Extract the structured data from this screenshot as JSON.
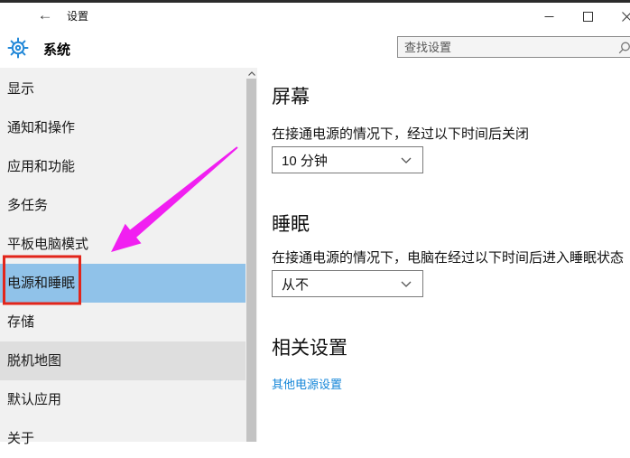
{
  "window": {
    "title": "设置",
    "controls": {
      "minimize": "minimize",
      "maximize": "maximize",
      "close": "close"
    }
  },
  "icons": {
    "back": "←"
  },
  "header": {
    "page_title": "系统",
    "search": {
      "placeholder": "查找设置"
    }
  },
  "sidebar": {
    "items": [
      {
        "label": "显示",
        "state": "normal"
      },
      {
        "label": "通知和操作",
        "state": "normal"
      },
      {
        "label": "应用和功能",
        "state": "normal"
      },
      {
        "label": "多任务",
        "state": "normal"
      },
      {
        "label": "平板电脑模式",
        "state": "normal"
      },
      {
        "label": "电源和睡眠",
        "state": "selected"
      },
      {
        "label": "存储",
        "state": "normal"
      },
      {
        "label": "脱机地图",
        "state": "hovered"
      },
      {
        "label": "默认应用",
        "state": "normal"
      },
      {
        "label": "关于",
        "state": "normal"
      }
    ]
  },
  "main": {
    "sections": [
      {
        "heading": "屏幕",
        "description": "在接通电源的情况下，经过以下时间后关闭",
        "dropdown_value": "10 分钟"
      },
      {
        "heading": "睡眠",
        "description": "在接通电源的情况下，电脑在经过以下时间后进入睡眠状态",
        "dropdown_value": "从不"
      },
      {
        "heading": "相关设置",
        "link_label": "其他电源设置"
      }
    ]
  },
  "annotations": {
    "arrow_color": "#f11ff1",
    "box_color": "#e2251b"
  },
  "colors": {
    "accent_gear": "#2288d8",
    "selected_item_bg": "#90c2e9",
    "hovered_item_bg": "#dedede",
    "sidebar_bg": "#f1f1f1",
    "link_blue": "#1586d8"
  }
}
